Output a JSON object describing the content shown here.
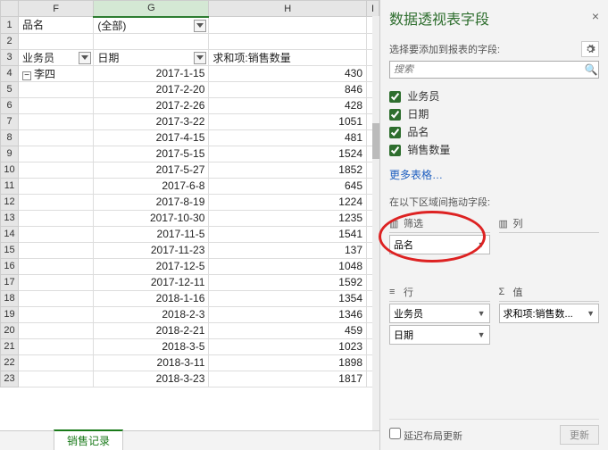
{
  "columns": [
    "F",
    "G",
    "H",
    "I"
  ],
  "filterRow": {
    "label": "品名",
    "value": "(全部)"
  },
  "headers": {
    "f": "业务员",
    "g": "日期",
    "h": "求和项:销售数量"
  },
  "person": "李四",
  "rows": [
    {
      "n": "1"
    },
    {
      "n": "2"
    },
    {
      "n": "3"
    },
    {
      "n": "4",
      "g": "2017-1-15",
      "h": "430"
    },
    {
      "n": "5",
      "g": "2017-2-20",
      "h": "846"
    },
    {
      "n": "6",
      "g": "2017-2-26",
      "h": "428"
    },
    {
      "n": "7",
      "g": "2017-3-22",
      "h": "1051"
    },
    {
      "n": "8",
      "g": "2017-4-15",
      "h": "481"
    },
    {
      "n": "9",
      "g": "2017-5-15",
      "h": "1524"
    },
    {
      "n": "10",
      "g": "2017-5-27",
      "h": "1852"
    },
    {
      "n": "11",
      "g": "2017-6-8",
      "h": "645"
    },
    {
      "n": "12",
      "g": "2017-8-19",
      "h": "1224"
    },
    {
      "n": "13",
      "g": "2017-10-30",
      "h": "1235"
    },
    {
      "n": "14",
      "g": "2017-11-5",
      "h": "1541"
    },
    {
      "n": "15",
      "g": "2017-11-23",
      "h": "137"
    },
    {
      "n": "16",
      "g": "2017-12-5",
      "h": "1048"
    },
    {
      "n": "17",
      "g": "2017-12-11",
      "h": "1592"
    },
    {
      "n": "18",
      "g": "2018-1-16",
      "h": "1354"
    },
    {
      "n": "19",
      "g": "2018-2-3",
      "h": "1346"
    },
    {
      "n": "20",
      "g": "2018-2-21",
      "h": "459"
    },
    {
      "n": "21",
      "g": "2018-3-5",
      "h": "1023"
    },
    {
      "n": "22",
      "g": "2018-3-11",
      "h": "1898"
    },
    {
      "n": "23",
      "g": "2018-3-23",
      "h": "1817"
    }
  ],
  "sheetTab": "销售记录",
  "pane": {
    "title": "数据透视表字段",
    "subtitle": "选择要添加到报表的字段:",
    "searchPlaceholder": "搜索",
    "fields": [
      "业务员",
      "日期",
      "品名",
      "销售数量"
    ],
    "moreTables": "更多表格…",
    "dragLabel": "在以下区域间拖动字段:",
    "zones": {
      "filter": {
        "title": "筛选",
        "items": [
          "品名"
        ]
      },
      "columns": {
        "title": "列",
        "items": []
      },
      "rows": {
        "title": "行",
        "items": [
          "业务员",
          "日期"
        ]
      },
      "values": {
        "title": "值",
        "items": [
          "求和项:销售数..."
        ]
      }
    },
    "deferLabel": "延迟布局更新",
    "updateBtn": "更新"
  },
  "chart_data": {
    "type": "table",
    "title": "数据透视表 - 李四 销售数量",
    "filter": {
      "品名": "(全部)"
    },
    "row_fields": [
      "业务员",
      "日期"
    ],
    "value_field": "求和项:销售数量",
    "categories": [
      "2017-1-15",
      "2017-2-20",
      "2017-2-26",
      "2017-3-22",
      "2017-4-15",
      "2017-5-15",
      "2017-5-27",
      "2017-6-8",
      "2017-8-19",
      "2017-10-30",
      "2017-11-5",
      "2017-11-23",
      "2017-12-5",
      "2017-12-11",
      "2018-1-16",
      "2018-2-3",
      "2018-2-21",
      "2018-3-5",
      "2018-3-11",
      "2018-3-23"
    ],
    "values": [
      430,
      846,
      428,
      1051,
      481,
      1524,
      1852,
      645,
      1224,
      1235,
      1541,
      137,
      1048,
      1592,
      1354,
      1346,
      459,
      1023,
      1898,
      1817
    ]
  }
}
